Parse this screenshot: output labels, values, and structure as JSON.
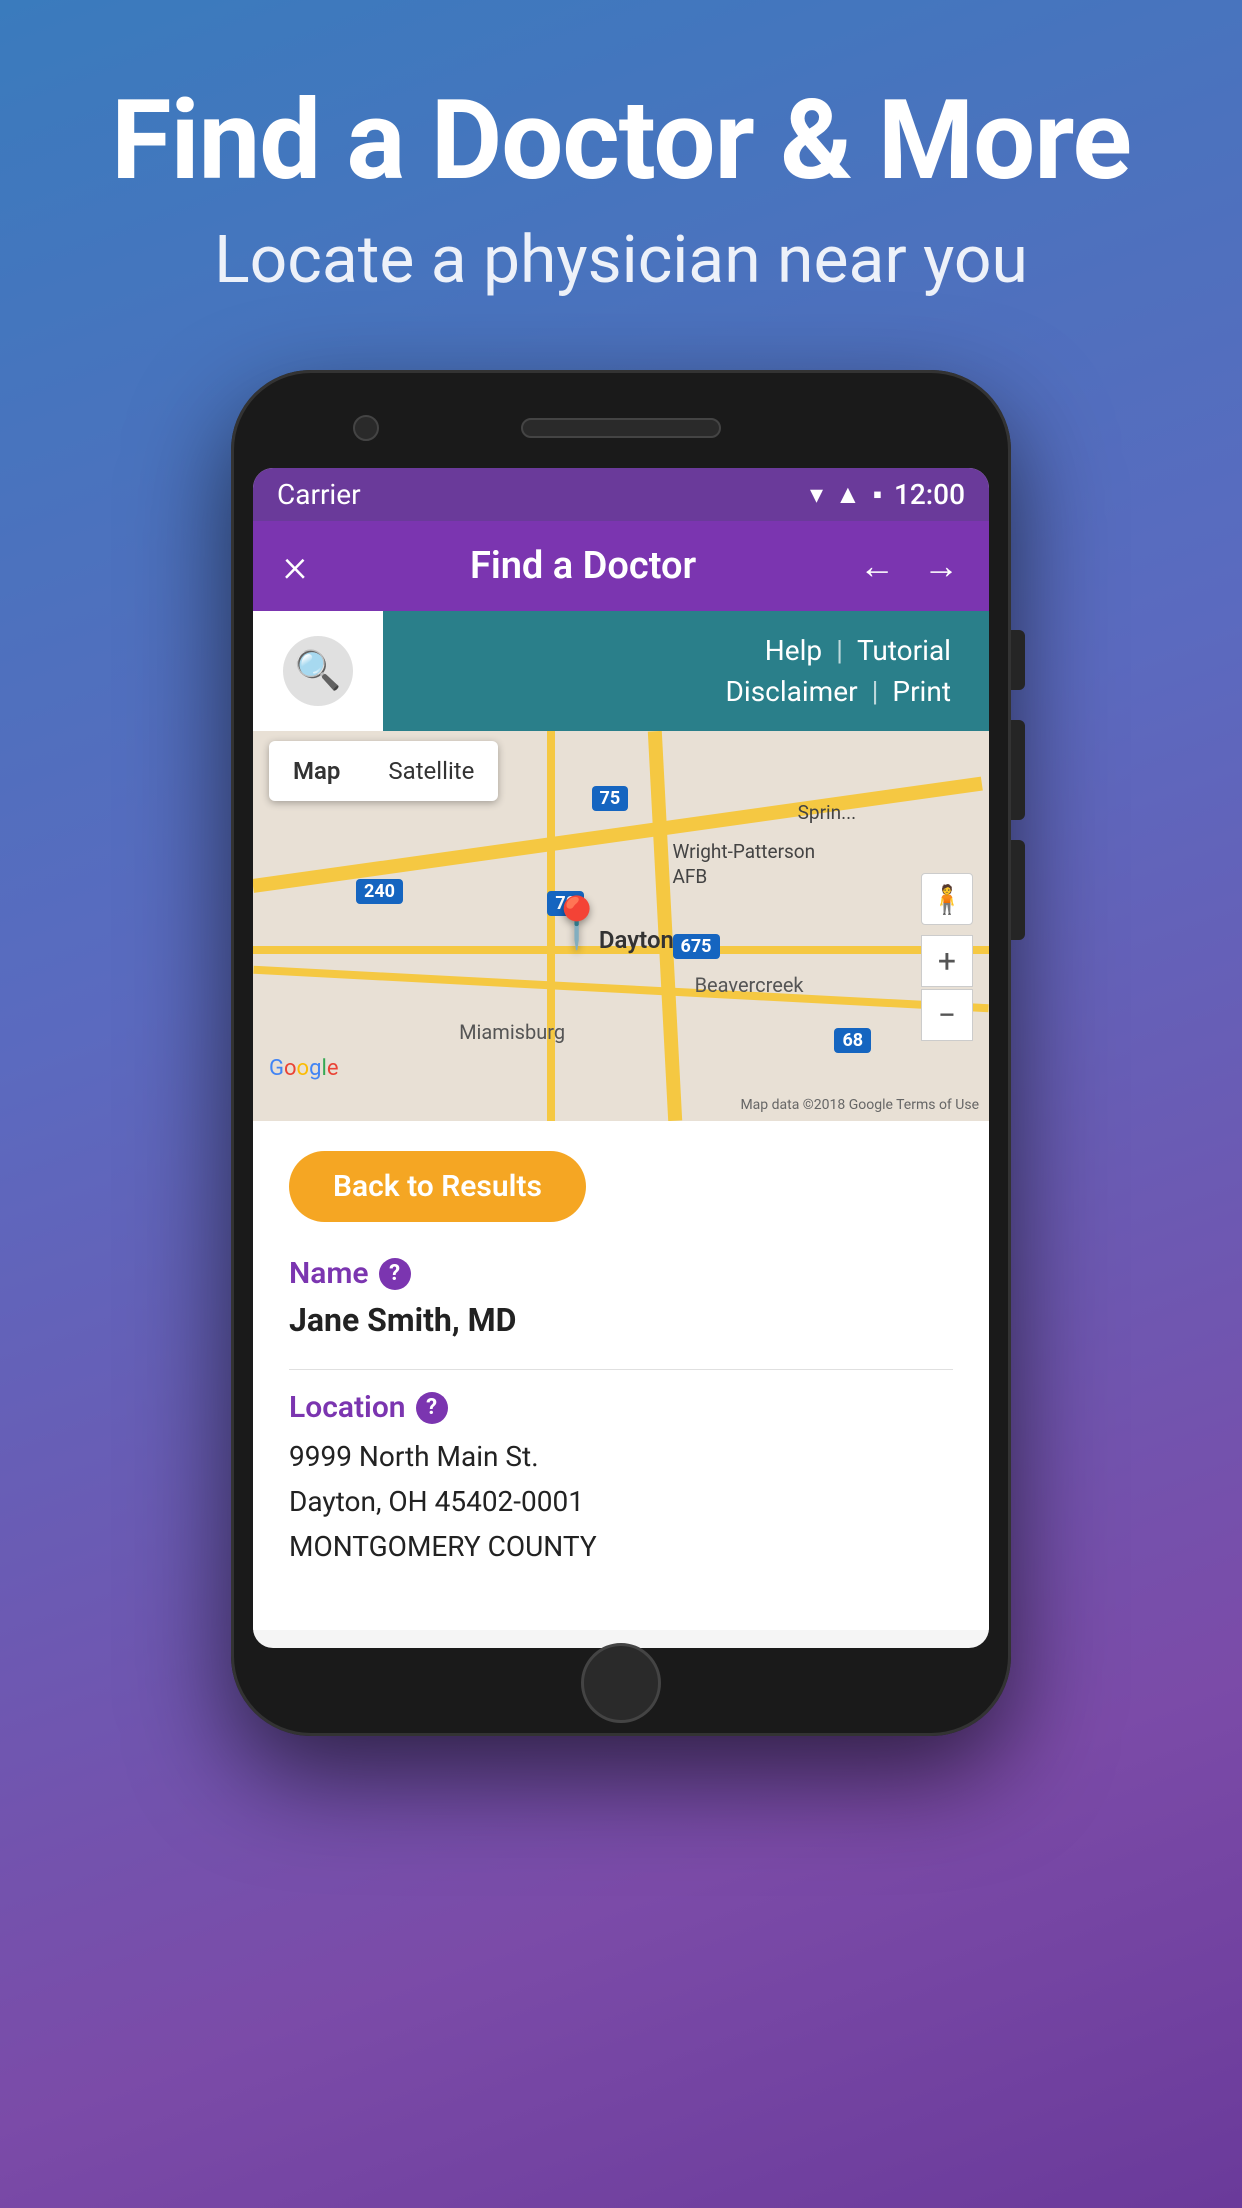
{
  "hero": {
    "title": "Find a Doctor & More",
    "subtitle": "Locate a physician near you"
  },
  "phone": {
    "statusBar": {
      "carrier": "Carrier",
      "time": "12:00"
    },
    "appBar": {
      "title": "Find a Doctor",
      "close_label": "×",
      "back_label": "←",
      "forward_label": "→"
    },
    "navLinks": {
      "help": "Help",
      "tutorial": "Tutorial",
      "disclaimer": "Disclaimer",
      "print": "Print",
      "separator": "|"
    },
    "map": {
      "tab_map": "Map",
      "tab_satellite": "Satellite",
      "labels": {
        "dayton": "Dayton",
        "wright": "Wright-Patterson\nAFB",
        "beavercreek": "Beavercreek",
        "miamisburg": "Miamisburg",
        "spring": "Sprin..."
      },
      "google_logo": "Google",
      "attribution": "Map data ©2018 Google   Terms of Use"
    },
    "content": {
      "back_button": "Back to Results",
      "name_label": "Name",
      "name_value": "Jane Smith, MD",
      "location_label": "Location",
      "location_line1": "9999 North Main St.",
      "location_line2": "Dayton, OH 45402-0001",
      "location_line3": "MONTGOMERY COUNTY"
    }
  },
  "colors": {
    "purple_dark": "#7b35b0",
    "teal": "#2a7f8a",
    "orange": "#f5a623",
    "status_bar": "#6a3a9a"
  }
}
